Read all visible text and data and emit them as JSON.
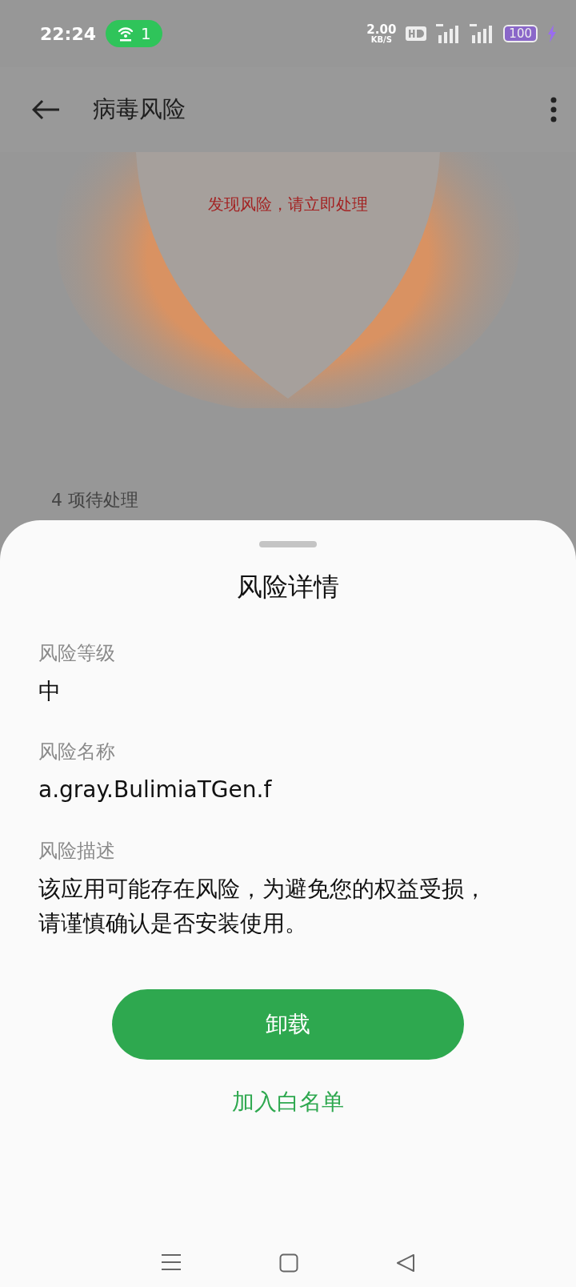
{
  "status_bar": {
    "time": "22:24",
    "hotspot_count": "1",
    "net_speed": "2.00",
    "net_speed_unit": "KB/S",
    "battery": "100"
  },
  "header": {
    "title": "病毒风险"
  },
  "scan_result": {
    "message": "发现风险，请立即处理"
  },
  "pending": {
    "label": "4 项待处理"
  },
  "sheet": {
    "title": "风险详情",
    "fields": [
      {
        "label": "风险等级",
        "value": "中"
      },
      {
        "label": "风险名称",
        "value": "a.gray.BulimiaTGen.f"
      },
      {
        "label": "风险描述",
        "value": "该应用可能存在风险，为避免您的权益受损，请谨慎确认是否安装使用。"
      }
    ],
    "primary_button": "卸载",
    "secondary_button": "加入白名单"
  }
}
